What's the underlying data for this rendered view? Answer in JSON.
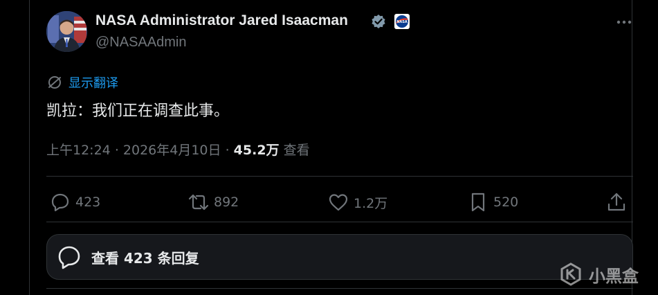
{
  "author": {
    "display_name": "NASA Administrator Jared Isaacman",
    "handle": "@NASAAdmin",
    "verified_icon": "verified-badge-icon",
    "affiliation_icon": "nasa-logo-icon",
    "affiliation_text": "NASA"
  },
  "post": {
    "translate_label": "显示翻译",
    "text": "凯拉：我们正在调查此事。",
    "time": "上午12:24",
    "date": "2026年4月10日",
    "separator": "·",
    "views_count": "45.2万",
    "views_label": "查看"
  },
  "actions": {
    "reply_count": "423",
    "retweet_count": "892",
    "like_count": "1.2万",
    "bookmark_count": "520"
  },
  "replies": {
    "label": "查看 423 条回复"
  },
  "watermark": {
    "text": "小黑盒"
  },
  "colors": {
    "background": "#000000",
    "text_primary": "#e7e9ea",
    "text_secondary": "#71767b",
    "accent": "#1d9bf0",
    "border": "#2f3336"
  }
}
